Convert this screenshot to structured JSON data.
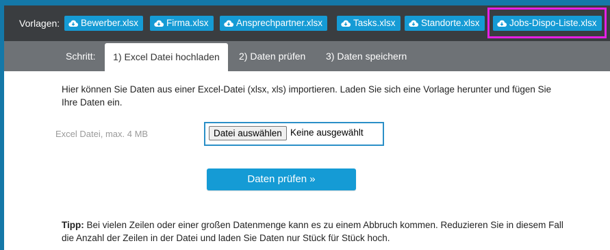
{
  "vorlagen": {
    "label": "Vorlagen:",
    "templates": [
      {
        "label": "Bewerber.xlsx",
        "icon": "cloud-download-icon"
      },
      {
        "label": "Firma.xlsx",
        "icon": "cloud-download-icon"
      },
      {
        "label": "Ansprechpartner.xlsx",
        "icon": "cloud-download-icon"
      },
      {
        "label": "Tasks.xlsx",
        "icon": "cloud-download-icon"
      },
      {
        "label": "Standorte.xlsx",
        "icon": "cloud-download-icon"
      },
      {
        "label": "Jobs-Dispo-Liste.xlsx",
        "icon": "cloud-download-icon"
      }
    ]
  },
  "steps": {
    "label": "Schritt:",
    "tabs": [
      {
        "label": "1) Excel Datei hochladen",
        "active": true
      },
      {
        "label": "2) Daten prüfen",
        "active": false
      },
      {
        "label": "3) Daten speichern",
        "active": false
      }
    ]
  },
  "content": {
    "intro": "Hier können Sie Daten aus einer Excel-Datei (xlsx, xls) importieren. Laden Sie sich eine Vorlage herunter und fügen Sie Ihre Daten ein.",
    "file_label": "Excel Datei, max. 4 MB",
    "file_button": "Datei auswählen",
    "file_status": "Keine ausgewählt",
    "submit_label": "Daten prüfen »",
    "tip_label": "Tipp:",
    "tip_text": " Bei vielen Zeilen oder einer großen Datenmenge kann es zu einem Abbruch kommen. Reduzieren Sie in diesem Fall die Anzahl der Zeilen in der Datei und laden Sie Daten nur Stück für Stück hoch."
  },
  "colors": {
    "accent": "#159bd5",
    "header_dark": "#3a3d40",
    "steps_gray": "#6e7276",
    "highlight": "#e620e6",
    "file_border": "#2a8fc7"
  }
}
